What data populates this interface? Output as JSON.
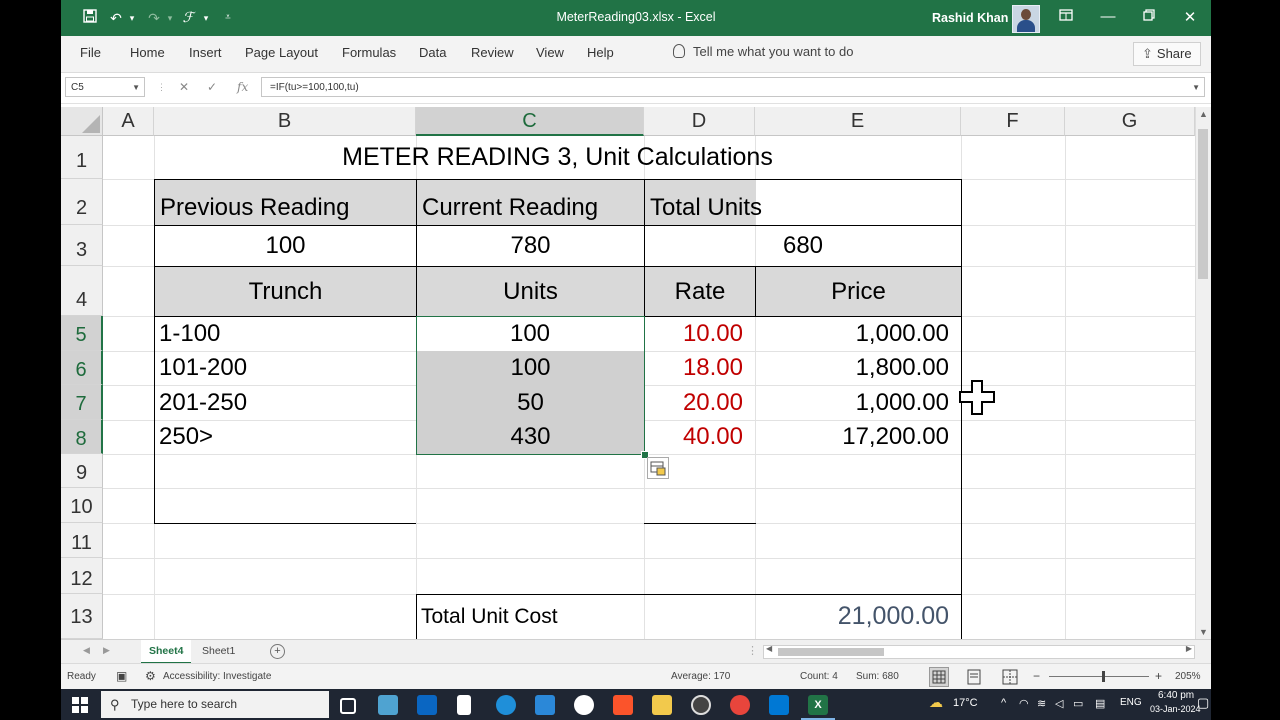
{
  "window": {
    "doc_title": "MeterReading03.xlsx  -  Excel",
    "user_name": "Rashid Khan"
  },
  "menu": [
    "File",
    "Home",
    "Insert",
    "Page Layout",
    "Formulas",
    "Data",
    "Review",
    "View",
    "Help"
  ],
  "tell_me": "Tell me what you want to do",
  "share_label": "Share",
  "formula_bar": {
    "name_box": "C5",
    "formula": "=IF(tu>=100,100,tu)"
  },
  "columns": [
    "A",
    "B",
    "C",
    "D",
    "E",
    "F",
    "G"
  ],
  "rows": [
    "1",
    "2",
    "3",
    "4",
    "5",
    "6",
    "7",
    "8",
    "9",
    "10",
    "11",
    "12",
    "13"
  ],
  "sheet": {
    "title": "METER READING 3, Unit Calculations",
    "previous_reading_label": "Previous Reading",
    "current_reading_label": "Current Reading",
    "total_units_label": "Total Units",
    "previous_reading": "100",
    "current_reading": "780",
    "total_units": "680",
    "headers": {
      "trunch": "Trunch",
      "units": "Units",
      "rate": "Rate",
      "price": "Price"
    },
    "data_rows": [
      {
        "trunch": "1-100",
        "units": "100",
        "rate": "10.00",
        "price": "1,000.00"
      },
      {
        "trunch": "101-200",
        "units": "100",
        "rate": "18.00",
        "price": "1,800.00"
      },
      {
        "trunch": "201-250",
        "units": "50",
        "rate": "20.00",
        "price": "1,000.00"
      },
      {
        "trunch": "250>",
        "units": "430",
        "rate": "40.00",
        "price": "17,200.00"
      }
    ],
    "total_label": "Total Unit Cost",
    "total_value": "21,000.00"
  },
  "tabs": [
    "Sheet4",
    "Sheet1"
  ],
  "status": {
    "ready": "Ready",
    "accessibility": "Accessibility: Investigate",
    "average": "Average: 170",
    "count": "Count: 4",
    "sum": "Sum: 680",
    "zoom": "205%"
  },
  "taskbar": {
    "search_placeholder": "Type here to search",
    "weather": "17°C",
    "lang": "ENG",
    "time": "6:40 pm",
    "date": "03-Jan-2024"
  },
  "colors": {
    "accent": "#217346",
    "rate_text": "#c00000",
    "header_fill": "#d9d9d9"
  }
}
